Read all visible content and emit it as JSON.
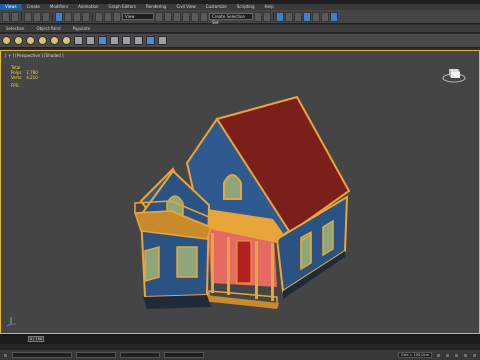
{
  "menubar": {
    "items": [
      "Views",
      "Create",
      "Modifiers",
      "Animation",
      "Graph Editors",
      "Rendering",
      "Civil View",
      "Customize",
      "Scripting",
      "Help"
    ]
  },
  "toolbar": {
    "view_combo": "View",
    "selection_set_placeholder": "Create Selection Set"
  },
  "ribbon": {
    "tabs": [
      "Selection",
      "Object Paint",
      "Populate"
    ]
  },
  "viewport": {
    "label": "[ + ] [Perspective ] [Shaded ]",
    "stats": {
      "title": "Total",
      "polys_label": "Polys:",
      "polys_value": "2,780",
      "verts_label": "Verts:",
      "verts_value": "4,210",
      "fps_label": "FPS:"
    }
  },
  "timeline": {
    "frame": "0 / 100"
  },
  "status": {
    "grid": "Grid = 100,0cm"
  },
  "colors": {
    "wall": "#2f5a8f",
    "roof": "#7a1f1a",
    "trim": "#e8a63a",
    "window": "#8ea77a",
    "door": "#b32020",
    "porch_wall": "#e46a63",
    "viewport_border": "#e0b840"
  }
}
